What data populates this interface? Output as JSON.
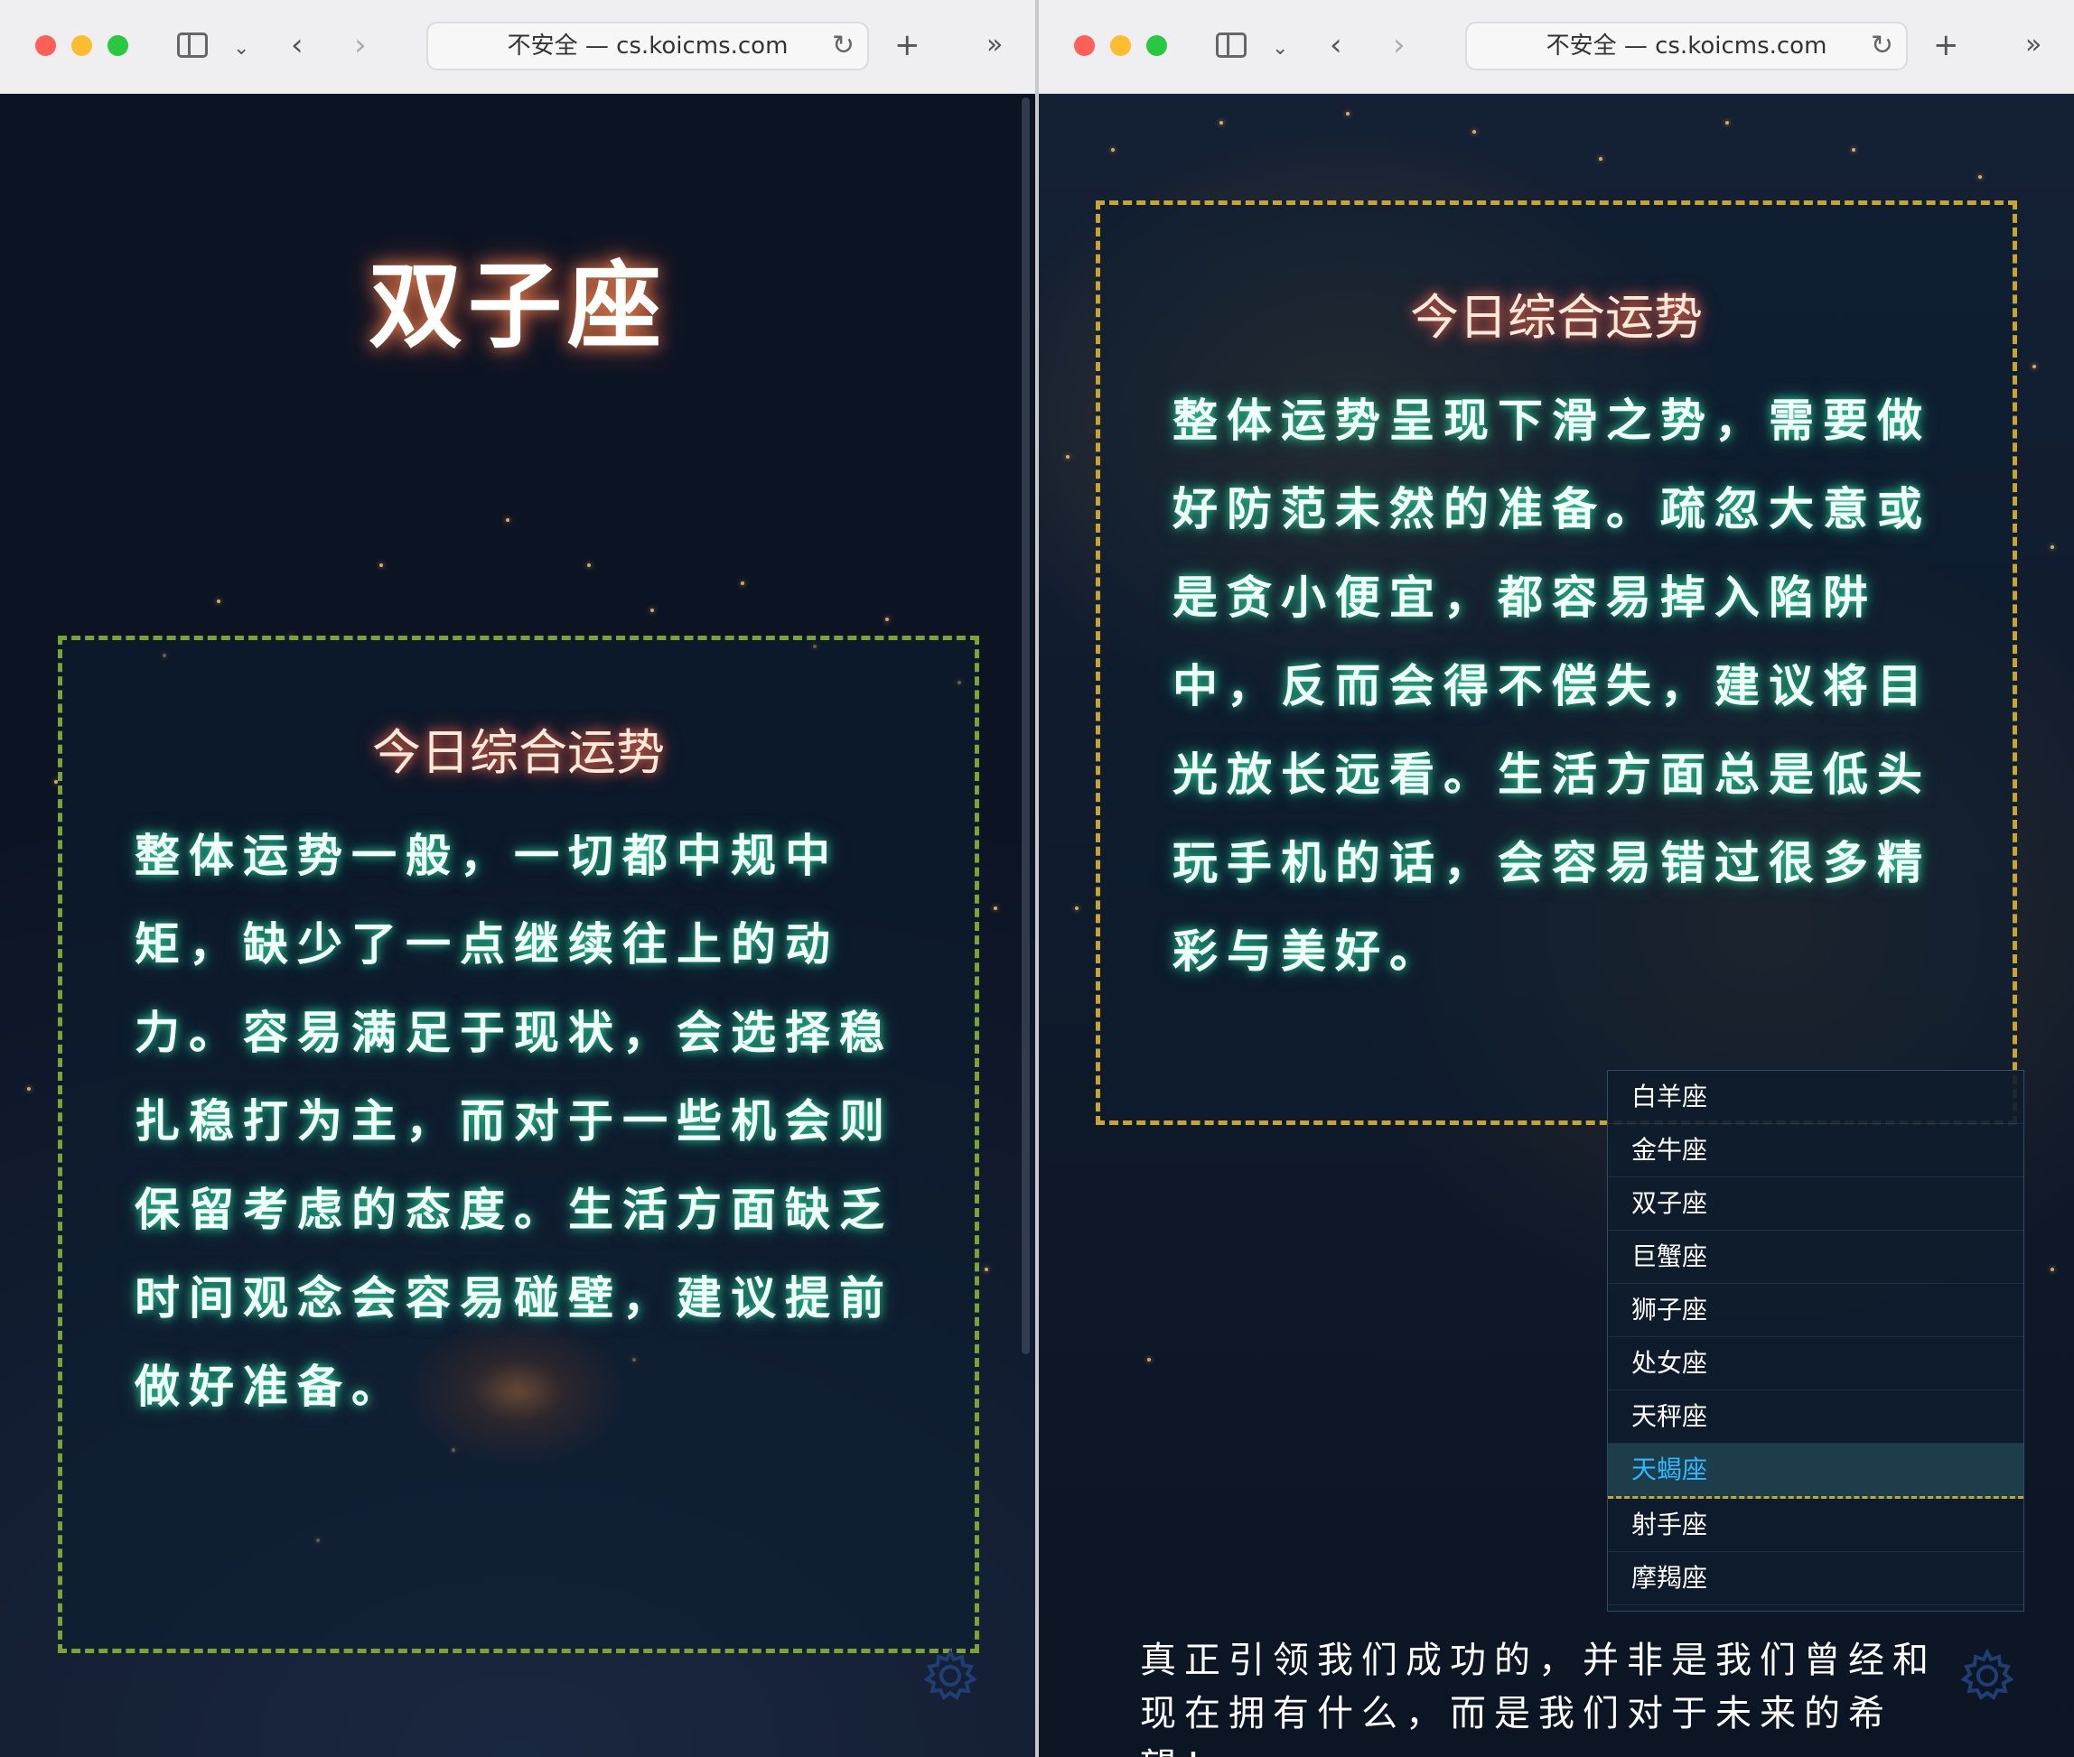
{
  "browser": {
    "address_text": "不安全 — cs.koicms.com",
    "traffic_colors": [
      "#fe5f57",
      "#febc2e",
      "#28c840"
    ]
  },
  "left": {
    "sign_title": "双子座",
    "box_heading": "今日综合运势",
    "box_text": "整体运势一般，一切都中规中矩，缺少了一点继续往上的动力。容易满足于现状，会选择稳扎稳打为主，而对于一些机会则保留考虑的态度。生活方面缺乏时间观念会容易碰壁，建议提前做好准备。"
  },
  "right": {
    "box_heading": "今日综合运势",
    "box_text": "整体运势呈现下滑之势，需要做好防范未然的准备。疏忽大意或是贪小便宜，都容易掉入陷阱中，反而会得不偿失，建议将目光放长远看。生活方面总是低头玩手机的话，会容易错过很多精彩与美好。",
    "quote": "真正引领我们成功的，并非是我们曾经和现在拥有什么，而是我们对于未来的希望！",
    "menu": {
      "items": [
        "白羊座",
        "金牛座",
        "双子座",
        "巨蟹座",
        "狮子座",
        "处女座",
        "天秤座",
        "天蝎座",
        "射手座",
        "摩羯座"
      ],
      "selected": "天蝎座"
    }
  },
  "icons": {
    "sidebar": "sidebar-icon",
    "back": "chevron-left-icon",
    "forward": "chevron-right-icon",
    "new_tab": "plus-icon",
    "more": "double-chevron-icon",
    "settings": "gear-icon"
  }
}
